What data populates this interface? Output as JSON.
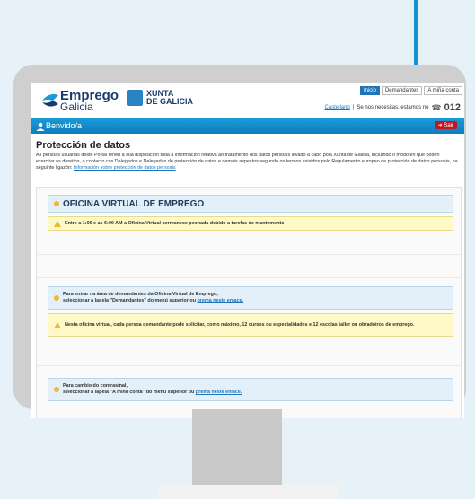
{
  "header": {
    "logo_line1": "Emprego",
    "logo_line2": "Galicia",
    "xunta_line1": "XUNTA",
    "xunta_line2": "DE GALICIA",
    "nav": [
      "Inicio",
      "Demandantes",
      "A miña conta"
    ],
    "lang_link": "Castellano",
    "help_text": "Se nos necesitas, estamos no",
    "phone": "012"
  },
  "bar": {
    "welcome": "Benvido/a",
    "logout": "Sair"
  },
  "protection": {
    "title": "Protección de datos",
    "text": "As persoas usuarias deste Portal teñen á súa disposición toda a información relativa ao tratamento dos datos persoais levado a cabo pola Xunta de Galicia, incluíndo o modo en que poden exercitar os dereitos, o contacto cos Delegados e Delegadas de protección de datos e demais aspectos segundo os termos esixidos polo Regulamento europeo de protección de datos persoais, na seguinte ligazón:",
    "link": "Información sobre protección de datos persoais"
  },
  "office": {
    "title": "OFICINA VIRTUAL DE EMPREGO",
    "warning1": "Entre a 1:00 e as 6:00 AM a Oficina Virtual permanece pechada debido a tarefas de mantemento",
    "info1_line1": "Para entrar na área de demandantes da Oficina Virtual de Emprego,",
    "info1_line2": "seleccionar a lapela \"Demandantes\" do menú superior ou",
    "info1_link": "prema neste enlace.",
    "warning2": "Nesta oficina virtual, cada persoa demandante pode solicitar, como máximo, 12 cursos ou especialidades e 12 escolas taller ou obradoiros de emprego.",
    "info2_line1": "Para cambio do contrasinal,",
    "info2_line2": "seleccionar a lapela \"A miña conta\" do menú superior ou",
    "info2_link": "prema neste enlace."
  }
}
